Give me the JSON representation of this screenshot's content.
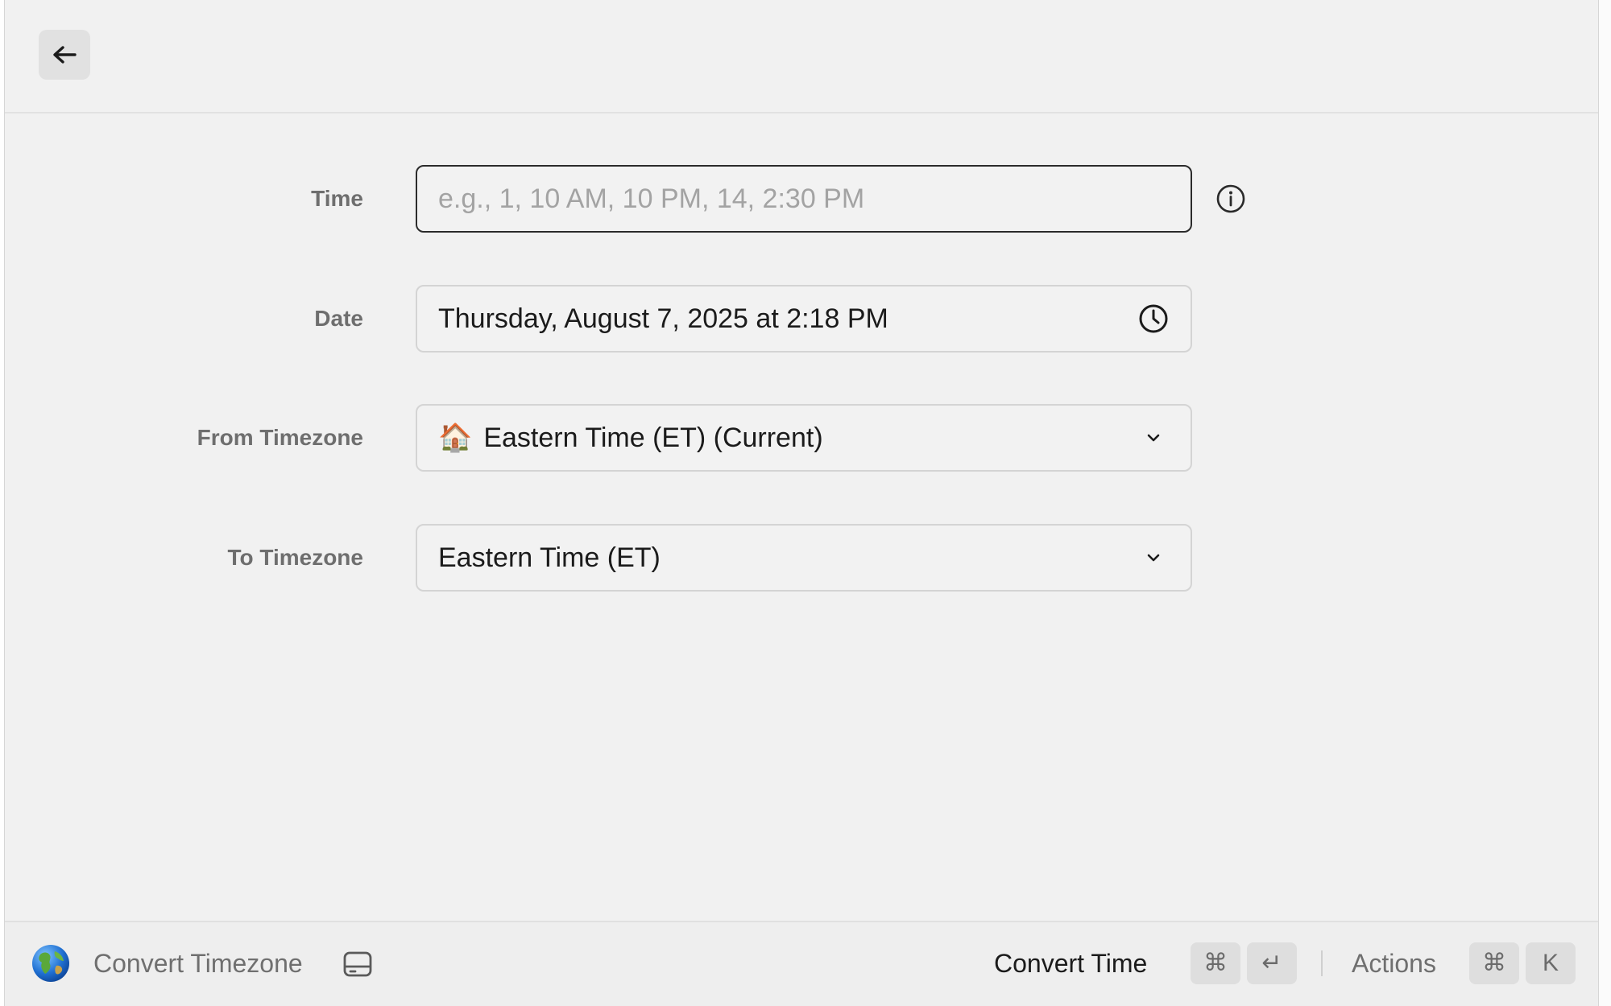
{
  "header": {
    "back_icon": "arrow-left-icon"
  },
  "form": {
    "time": {
      "label": "Time",
      "placeholder": "e.g., 1, 10 AM, 10 PM, 14, 2:30 PM",
      "value": "",
      "info_icon": "info-icon"
    },
    "date": {
      "label": "Date",
      "value": "Thursday, August 7, 2025 at 2:18 PM",
      "icon": "clock-icon"
    },
    "from_timezone": {
      "label": "From Timezone",
      "emoji": "🏠",
      "value": "Eastern Time (ET) (Current)",
      "icon": "chevron-down-icon"
    },
    "to_timezone": {
      "label": "To Timezone",
      "value": "Eastern Time (ET)",
      "icon": "chevron-down-icon"
    }
  },
  "footer": {
    "extension_icon": "globe-icon",
    "title": "Convert Timezone",
    "title_icon": "hard-drive-icon",
    "primary_action": "Convert Time",
    "primary_shortcut": [
      "⌘",
      "↵"
    ],
    "secondary_action": "Actions",
    "secondary_shortcut": [
      "⌘",
      "K"
    ]
  },
  "colors": {
    "background": "#f1f1f1",
    "field_border": "#d4d4d4",
    "focused_border": "#2b2b2b",
    "label": "#6e6e6e",
    "placeholder": "#a3a3a3"
  }
}
